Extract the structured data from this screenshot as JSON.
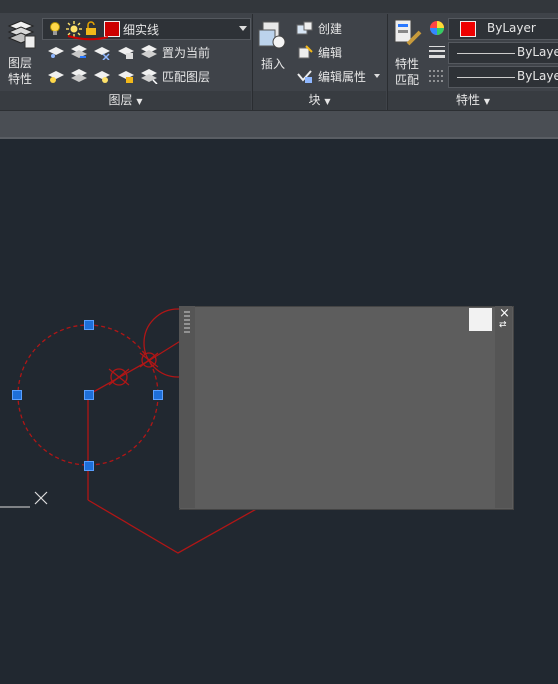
{
  "ribbon": {
    "layer_panel": {
      "title": "图层",
      "layer_props_label_line1": "图层",
      "layer_props_label_line2": "特性",
      "current_layer_name": "细实线",
      "current_layer_color": "#cc0000",
      "set_current_label": "置为当前",
      "match_layer_label": "匹配图层"
    },
    "block_panel": {
      "title": "块",
      "insert_label": "插入",
      "create_label": "创建",
      "edit_label": "编辑",
      "edit_attr_label": "编辑属性"
    },
    "properties_panel": {
      "title": "特性",
      "match_label_line1": "特性",
      "match_label_line2": "匹配",
      "color_value": "ByLayer",
      "color_swatch": "#ee0000",
      "linetype_value": "ByLayer",
      "lineweight_value": "ByLayer"
    }
  },
  "popup": {
    "close_glyph": "×",
    "options_glyph": "⇄"
  },
  "colors": {
    "canvas": "#212830",
    "entity": "#b01616",
    "grip": "#1e6fd9"
  }
}
